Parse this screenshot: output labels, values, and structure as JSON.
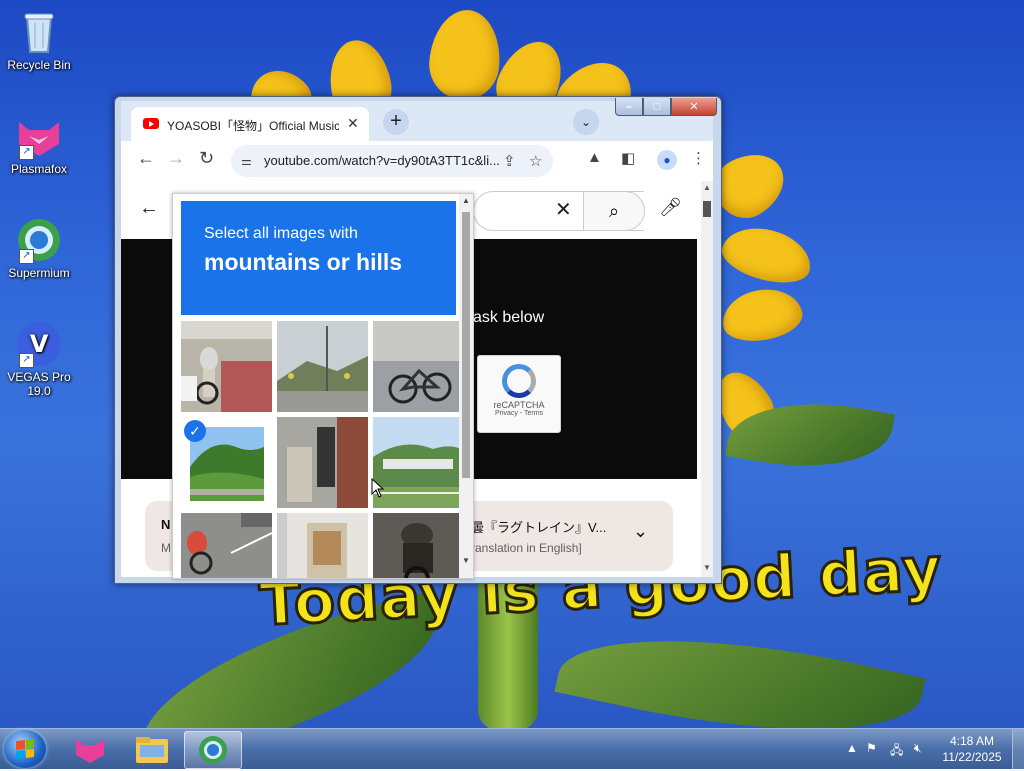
{
  "desktop": {
    "wallpaper_text": "Today is a good day",
    "icons": [
      {
        "label": "Recycle Bin"
      },
      {
        "label": "Plasmafox"
      },
      {
        "label": "Supermium"
      },
      {
        "label": "VEGAS Pro 19.0"
      }
    ]
  },
  "browser": {
    "tab": {
      "title": "YOASOBI「怪物」Official Music V",
      "close": "✕"
    },
    "new_tab": "+",
    "tab_search": "⌄",
    "url": "youtube.com/watch?v=dy90tA3TT1c&li...",
    "caption": {
      "minimize": "–",
      "maximize": "□",
      "close": "✕"
    }
  },
  "youtube": {
    "player_message": "ask below",
    "recaptcha": {
      "brand": "reCAPTCHA",
      "links": "Privacy - Terms"
    },
    "card": {
      "left_title": "N",
      "left_sub": "M",
      "title": "曇『ラグトレイン』V...",
      "subtitle": "ranslation in English]"
    }
  },
  "captcha": {
    "instruction": "Select all images with",
    "target": "mountains or hills",
    "tiles": [
      {
        "name": "tile-cyclist-road",
        "selected": false
      },
      {
        "name": "tile-mountain-road",
        "selected": false
      },
      {
        "name": "tile-bicycle-wall",
        "selected": false
      },
      {
        "name": "tile-green-hill",
        "selected": true
      },
      {
        "name": "tile-building-door",
        "selected": false
      },
      {
        "name": "tile-hills-bridge",
        "selected": false
      },
      {
        "name": "tile-road-cyclist",
        "selected": false
      },
      {
        "name": "tile-house-window",
        "selected": false
      },
      {
        "name": "tile-motorcycle",
        "selected": false
      }
    ]
  },
  "taskbar": {
    "time": "4:18 AM",
    "date": "11/22/2025"
  }
}
